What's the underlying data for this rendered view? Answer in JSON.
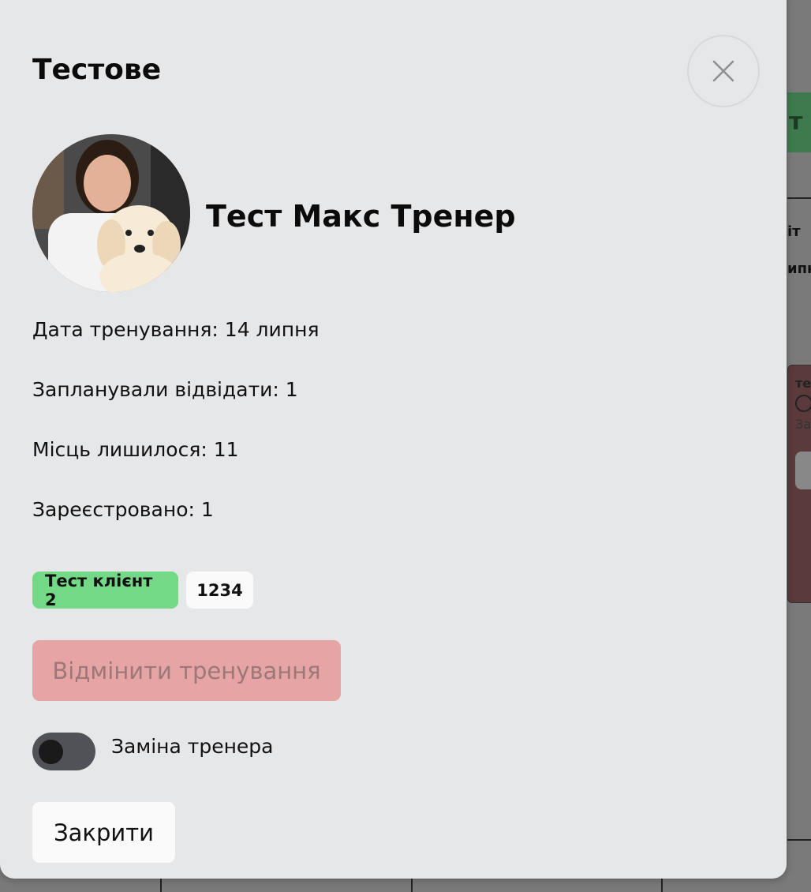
{
  "background": {
    "green_button_text": "т у",
    "column_label_1": "іт",
    "column_label_2": "ипн",
    "card_title": "те",
    "card_sub": "За"
  },
  "modal": {
    "title": "Тестове",
    "trainer_name": "Тест Макс Тренер",
    "info": {
      "training_date": "Дата тренування: 14 липня",
      "planned": "Запланували відвідати: 1",
      "spots_left": "Місць лишилося: 11",
      "registered": "Зареєстровано: 1"
    },
    "chips": {
      "client": "Тест клієнт 2",
      "code": "1234"
    },
    "cancel_training_label": "Відмінити тренування",
    "toggle": {
      "label": "Заміна тренера",
      "checked": false
    },
    "close_label": "Закрити"
  },
  "colors": {
    "modal_bg": "#e6e7e9",
    "client_chip": "#74d986",
    "cancel_button": "#e6a4a4",
    "toggle_track": "#505258"
  }
}
